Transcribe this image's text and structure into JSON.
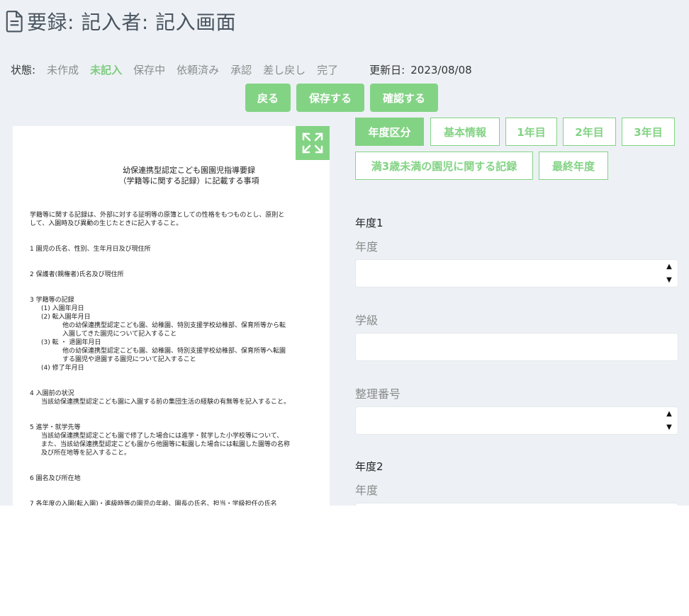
{
  "page_title": "要録: 記入者: 記入画面",
  "status": {
    "label": "状態:",
    "items": [
      "未作成",
      "未記入",
      "保存中",
      "依頼済み",
      "承認",
      "差し戻し",
      "完了"
    ],
    "active_index": 1,
    "updated_label": "更新日:",
    "updated_date": "2023/08/08"
  },
  "actions": {
    "back": "戻る",
    "save": "保存する",
    "confirm": "確認する"
  },
  "document": {
    "title_line1": "幼保連携型認定こども園園児指導要録",
    "title_line2": "（学籍等に関する記録）に記載する事項",
    "lines": [
      "学籍等に関する記録は、外部に対する証明等の原簿としての性格をもつものとし、原則と",
      "して、入園時及び異動の生じたときに記入すること。",
      "1 園児の氏名、性別、生年月日及び現住所",
      "2 保護者(親権者)氏名及び現住所",
      "3 学籍等の記録",
      "(1) 入園年月日",
      "(2) 転入園年月日",
      "他の幼保連携型認定こども園、幼稚園、特別支援学校幼稚部、保育所等から転",
      "入園してきた園児について記入すること",
      "(3) 転 ・ 退園年月日",
      "他の幼保連携型認定こども園、幼稚園、特別支援学校幼稚部、保育所等へ転園",
      "する園児や退園する園児について記入すること",
      "(4) 修了年月日",
      "4 入園前の状況",
      "当該幼保連携型認定こども園に入園する前の集団生活の経験の有無等を記入すること。",
      "5 進学・就学先等",
      "当該幼保連携型認定こども園で修了した場合には進学・就学した小学校等について、",
      "また、当該幼保連携型認定こども園から他園等に転園した場合には転園した園等の名称",
      "及び所在地等を記入すること。",
      "6 園名及び所在地",
      "7 各年度の入園(転入園)・進級時等の園児の年齢、園長の氏名、担当・学級担任の氏名"
    ]
  },
  "tabs": [
    "年度区分",
    "基本情報",
    "1年目",
    "2年目",
    "3年目",
    "満3歳未満の園児に関する記録",
    "最終年度"
  ],
  "form": {
    "section1_title": "年度1",
    "year_label": "年度",
    "class_label": "学級",
    "number_label": "整理番号",
    "section2_title": "年度2",
    "year2_label": "年度"
  },
  "icons": {
    "title": "file-text-icon",
    "expand": "expand-icon",
    "spin_up": "caret-up-icon",
    "spin_down": "caret-down-icon"
  },
  "colors": {
    "accent": "#83d385",
    "background": "#edf1f5"
  }
}
